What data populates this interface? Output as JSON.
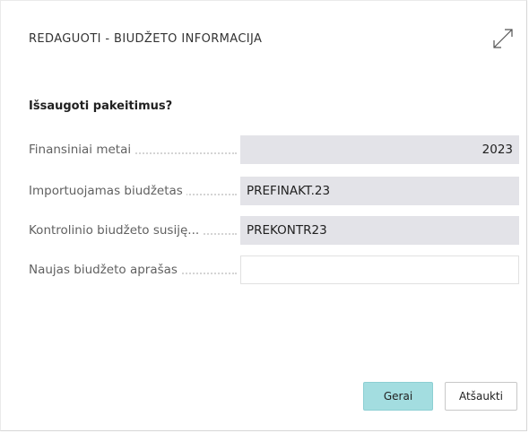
{
  "dialog": {
    "title": "REDAGUOTI - BIUDŽETO INFORMACIJA",
    "expand_icon": "expand-diagonal-arrows-icon",
    "question": "Išsaugoti pakeitimus?"
  },
  "fields": [
    {
      "label": "Finansiniai metai",
      "value": "2023",
      "editable": false
    },
    {
      "label": "Importuojamas biudžetas",
      "value": "PREFINAKT.23",
      "editable": false
    },
    {
      "label": "Kontrolinio biudžeto susiję...",
      "value": "PREKONTR23",
      "editable": false
    },
    {
      "label": "Naujas biudžeto aprašas",
      "value": "",
      "editable": true
    }
  ],
  "buttons": {
    "ok_label": "Gerai",
    "cancel_label": "Atšaukti"
  },
  "colors": {
    "readonly_field_bg": "#e3e3e8",
    "ok_button_bg": "#a3dde0",
    "label_text": "#616161"
  }
}
